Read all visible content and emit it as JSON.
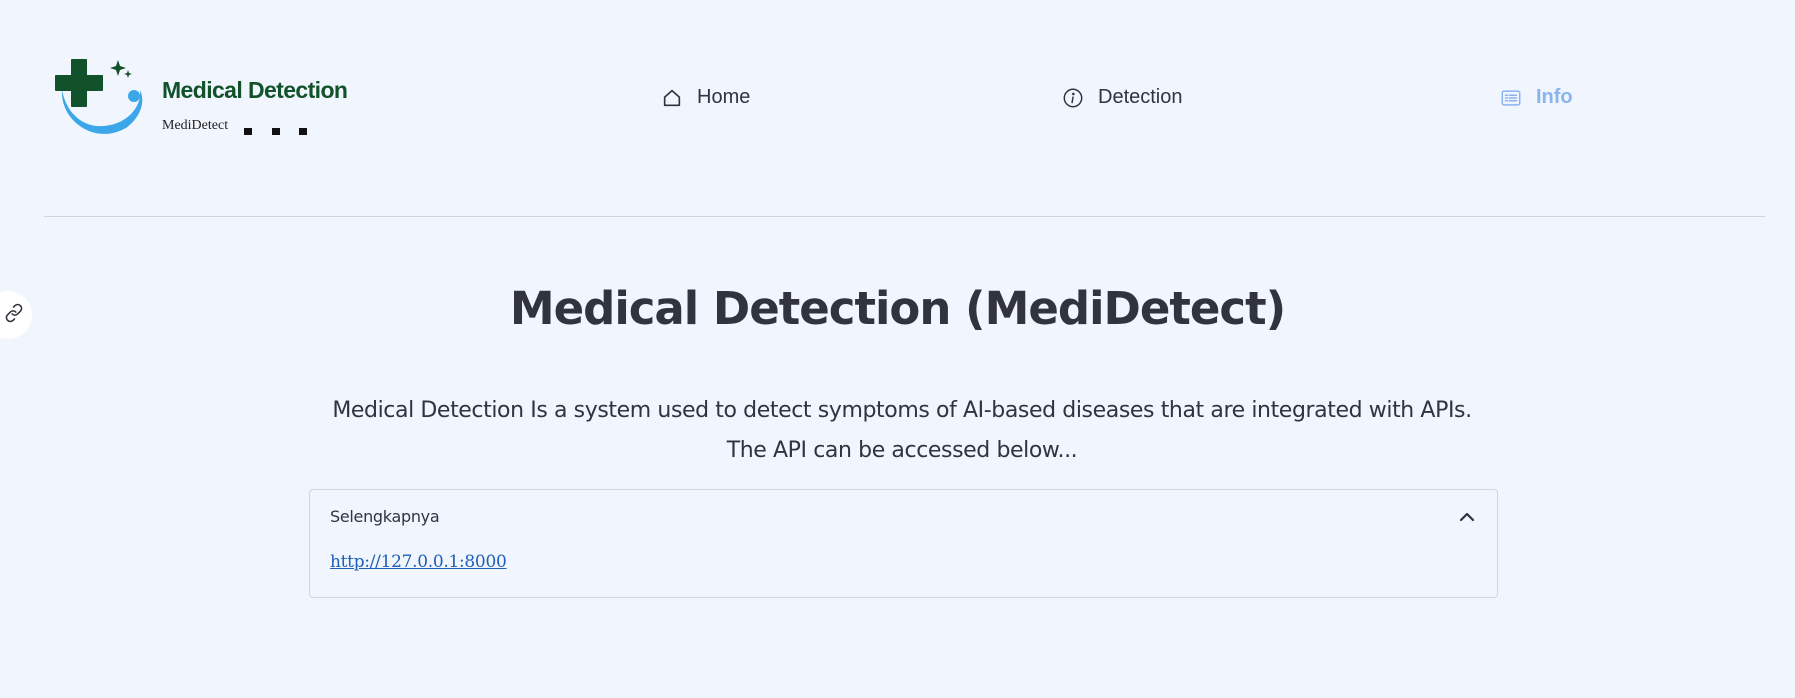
{
  "header": {
    "logo": {
      "title": "Medical Detection",
      "subtitle": "MediDetect"
    },
    "nav": [
      {
        "label": "Home",
        "icon": "home-icon"
      },
      {
        "label": "Detection",
        "icon": "info-circle-icon"
      },
      {
        "label": "Info",
        "icon": "list-card-icon",
        "active": true
      }
    ]
  },
  "main": {
    "title": "Medical Detection (MediDetect)",
    "description": "Medical Detection Is a system used to detect symptoms of AI-based diseases that are integrated with APIs. The API can be accessed below...",
    "expander": {
      "label": "Selengkapnya",
      "link_text": "http://127.0.0.1:8000",
      "expanded": true
    }
  },
  "colors": {
    "background": "#f0f5fe",
    "text": "#31333f",
    "active_nav": "#8ab4f0",
    "logo_green": "#12522a",
    "logo_blue": "#3ba7e8",
    "link": "#1f5fb6"
  }
}
